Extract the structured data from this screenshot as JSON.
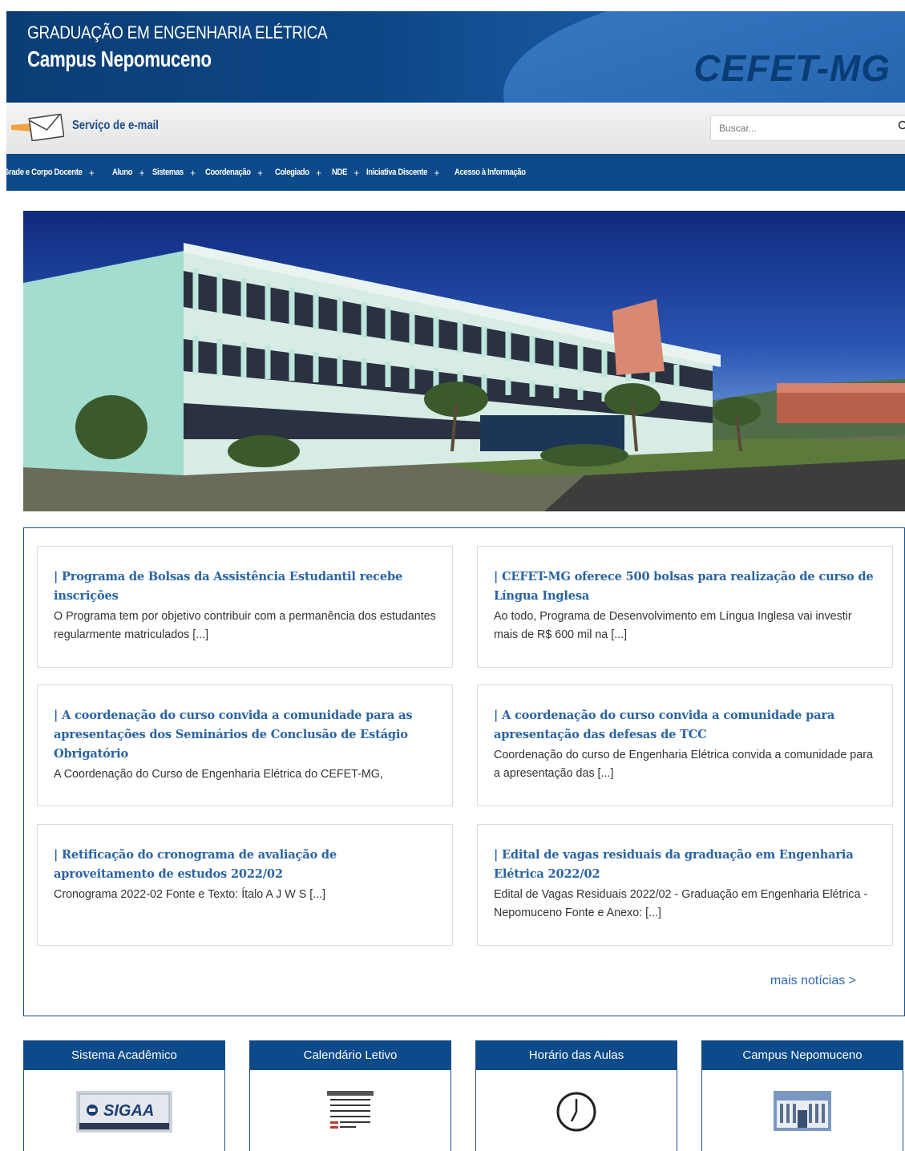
{
  "header": {
    "title_top": "GRADUAÇÃO EM ENGENHARIA ELÉTRICA",
    "title_main": "Campus Nepomuceno",
    "logo_text": "CEFET-MG"
  },
  "utility": {
    "mail_label": "Serviço de e-mail",
    "search_placeholder": "Buscar..."
  },
  "nav": {
    "items": [
      "Grade e Corpo Docente",
      "Aluno",
      "Sistemas",
      "Coordenação",
      "Colegiado",
      "NDE",
      "Iniciativa Discente",
      "Acesso à Informação"
    ]
  },
  "news": {
    "cards": [
      {
        "title": "| Programa de Bolsas da Assistência Estudantil recebe inscrições",
        "text": "O Programa tem por objetivo contribuir com a permanência dos estudantes regularmente matriculados [...]"
      },
      {
        "title": "| CEFET-MG oferece 500 bolsas para realização de curso de Língua Inglesa",
        "text": "Ao todo, Programa de Desenvolvimento em Língua Inglesa vai investir mais de R$ 600 mil na [...]"
      },
      {
        "title": "| A coordenação do curso convida a comunidade para as apresentações dos Seminários de Conclusão de Estágio Obrigatório",
        "text": "A Coordenação do Curso de Engenharia Elétrica do CEFET-MG,"
      },
      {
        "title": "| A coordenação do curso convida a comunidade para apresentação das defesas de TCC",
        "text": "Coordenação do curso de Engenharia Elétrica convida a comunidade para a apresentação das [...]"
      },
      {
        "title": "| Retificação do cronograma de avaliação de aproveitamento de estudos 2022/02",
        "text": "Cronograma 2022-02 Fonte e Texto: Ítalo A J W S [...]"
      },
      {
        "title": "| Edital de vagas residuais da graduação em Engenharia Elétrica 2022/02",
        "text": "Edital de Vagas Residuais 2022/02 - Graduação em Engenharia Elétrica - Nepomuceno Fonte e Anexo: [...]"
      }
    ],
    "more_label": "mais notícias >"
  },
  "boxes": [
    {
      "title": "Sistema Acadêmico",
      "icon": "sigaa-logo",
      "icon_text": "SIGAA"
    },
    {
      "title": "Calendário Letivo",
      "icon": "calendar-icon"
    },
    {
      "title": "Horário das Aulas",
      "icon": "clock-icon"
    },
    {
      "title": "Campus Nepomuceno",
      "icon": "campus-building-icon"
    }
  ]
}
